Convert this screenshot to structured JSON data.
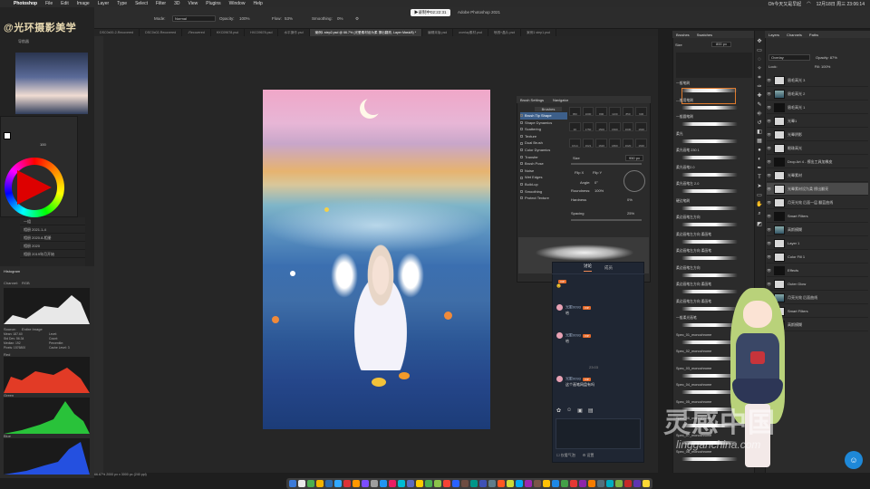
{
  "menubar": {
    "app": "Photoshop",
    "items": [
      "File",
      "Edit",
      "Image",
      "Layer",
      "Type",
      "Select",
      "Filter",
      "3D",
      "View",
      "Plugins",
      "Window",
      "Help"
    ],
    "right_text": "Oh今天又是早起",
    "clock": "12月18日 周三 23:06:14"
  },
  "options": {
    "mode_label": "Mode:",
    "mode_value": "Normal",
    "opacity_label": "Opacity:",
    "opacity_value": "100%",
    "flow_label": "Flow:",
    "flow_value": "53%",
    "smoothing_label": "Smoothing:",
    "smoothing_value": "0%",
    "timestamp": "▶录制中02:22:31",
    "doc_title": "Adobe Photoshop 2021"
  },
  "tabs": [
    {
      "label": "DSC0x00-2-Recovered"
    },
    {
      "label": "DSC0x02-Recovered"
    },
    {
      "label": "-Recovered"
    },
    {
      "label": "HXC09678.psd"
    },
    {
      "label": "HXC09678.psd"
    },
    {
      "label": "水平操作.psd"
    },
    {
      "label": "案例1 step2.psd @ 66.7% (光晕素材设为柔 擦出翻亮, Layer Mask/8) *",
      "active": true
    },
    {
      "label": "编辑末版.psd"
    },
    {
      "label": "overlay素材.psd"
    },
    {
      "label": "喷溅+晶片.psd"
    },
    {
      "label": "案例1 step1.psd"
    }
  ],
  "left": {
    "watermark": "@光环摄影美学",
    "navigator_label": "导航器",
    "color_percent": "100",
    "layers_items": [
      "一组",
      "相册 2021.1-4",
      "相册 2020.8-相册",
      "相册 2020",
      "相册 2019年月开始"
    ],
    "histogram": {
      "title": "Histogram",
      "channel_label": "Channel:",
      "channel_value": "RGB",
      "source_label": "Source:",
      "source_value": "Entire Image",
      "stats": [
        "Mean: 187.60",
        "Std Dev: 56.34",
        "Median: 192",
        "Pixels: 1576800",
        "Level:",
        "Count:",
        "Percentile:",
        "Cache Level: 3"
      ],
      "red_label": "Red",
      "green_label": "Green",
      "blue_label": "Blue"
    }
  },
  "brush_settings": {
    "tabs": [
      "Brush Settings",
      "Navigator"
    ],
    "brushes_label": "Brushes",
    "list": [
      {
        "label": "Brush Tip Shape",
        "selected": true
      },
      {
        "label": "Shape Dynamics"
      },
      {
        "label": "Scattering"
      },
      {
        "label": "Texture"
      },
      {
        "label": "Dual Brush"
      },
      {
        "label": "Color Dynamics"
      },
      {
        "label": "Transfer"
      },
      {
        "label": "Brush Pose"
      },
      {
        "label": "Noise"
      },
      {
        "label": "Wet Edges"
      },
      {
        "label": "Build-up"
      },
      {
        "label": "Smoothing"
      },
      {
        "label": "Protect Texture"
      }
    ],
    "tip_sizes": [
      "950",
      "1000",
      "800",
      "1100",
      "850",
      "930",
      "30",
      "1750",
      "1500",
      "1500",
      "1630",
      "1630",
      "1614",
      "1621",
      "1620",
      "1800",
      "1620",
      "1630"
    ],
    "size_label": "Size",
    "size_value": "950 px",
    "flip_x": "Flip X",
    "flip_y": "Flip Y",
    "angle_label": "Angle:",
    "angle_value": "0°",
    "roundness_label": "Roundness:",
    "roundness_value": "100%",
    "hardness_label": "Hardness",
    "hardness_value": "0%",
    "spacing_label": "Spacing",
    "spacing_value": "25%"
  },
  "chat": {
    "tabs": [
      "讨论",
      "成员"
    ],
    "messages": [
      {
        "nick": "",
        "tag": "VIP",
        "text": "😊"
      },
      {
        "nick": "光影0093",
        "tag": "VIP",
        "text": "哈"
      },
      {
        "nick": "光影0093",
        "tag": "VIP",
        "text": "哈"
      },
      {
        "nick": "光影0093",
        "tag": "VIP",
        "text": "这个画笔网盘有吗"
      }
    ],
    "date": "23:03",
    "tools": [
      "✿",
      "☺",
      "▣",
      "▤"
    ],
    "footer": [
      "☐ 仅看气泡",
      "⚙ 设置"
    ]
  },
  "brushes_panel": {
    "tabs": [
      "Brushes",
      "Swatches"
    ],
    "size_label": "Size",
    "size_value": "800 px",
    "groups": [
      {
        "label": "一般笔刷"
      },
      {
        "label": "—般用笔刷"
      },
      {
        "label": "一般圆笔刷"
      },
      {
        "label": "柔光"
      },
      {
        "label": "柔光画笔 230 1"
      },
      {
        "label": "柔光画笔2.0"
      },
      {
        "label": "柔光画笔左 2.0"
      },
      {
        "label": "硬边笔刷"
      },
      {
        "label": "柔边画笔左方向"
      },
      {
        "label": "柔边画笔左方向 柔画笔"
      },
      {
        "label": "柔边画笔左方向 柔画笔"
      },
      {
        "label": "柔边画笔左方向"
      },
      {
        "label": "柔边画笔左方向 柔画笔"
      },
      {
        "label": "柔边画笔左方向 柔画笔"
      },
      {
        "label": "一般柔光画笔"
      },
      {
        "label": "Spec_01_monochrome"
      },
      {
        "label": "Spec_02_monochrome"
      },
      {
        "label": "Spec_03_monochrome"
      },
      {
        "label": "Spec_04_monochrome"
      },
      {
        "label": "Spec_05_monochrome"
      },
      {
        "label": "Spec_06_monochrome"
      },
      {
        "label": "Spec_07_monochrome"
      },
      {
        "label": "Spec_08_monochrome"
      }
    ]
  },
  "layers_panel": {
    "tabs": [
      "Layers",
      "Channels",
      "Paths"
    ],
    "blend_mode": "Overlay",
    "opacity_label": "Opacity:",
    "opacity_value": "87%",
    "lock_label": "Lock:",
    "fill_label": "Fill:",
    "fill_value": "100%",
    "layers": [
      {
        "name": "眉毛高光 3"
      },
      {
        "name": "眉毛高光 2"
      },
      {
        "name": "眉毛高光 1"
      },
      {
        "name": "光晕1"
      },
      {
        "name": "光晕阴影"
      },
      {
        "name": "眼珠高光"
      },
      {
        "name": "Drop Art 4 - 擦出工具加橡皮"
      },
      {
        "name": "光晕素材"
      },
      {
        "name": "光晕素材设为柔 擦出翻亮",
        "selected": true
      },
      {
        "name": "月亮光效 后面一层 翻蓝曲线"
      },
      {
        "name": "Smart Filters"
      },
      {
        "name": "高斯模糊"
      },
      {
        "name": "Layer 1"
      },
      {
        "name": "Color Fill 1"
      },
      {
        "name": "Effects"
      },
      {
        "name": "Outer Glow"
      },
      {
        "name": "月亮光效 后面曲线"
      },
      {
        "name": "Smart Filters"
      },
      {
        "name": "高斯模糊"
      }
    ]
  },
  "status": {
    "zoom": "66.67%",
    "doc": "2000 px x 3000 px (240 ppi)"
  },
  "brand": {
    "logo": "灵感中国",
    "url": "lingganchina.com"
  }
}
